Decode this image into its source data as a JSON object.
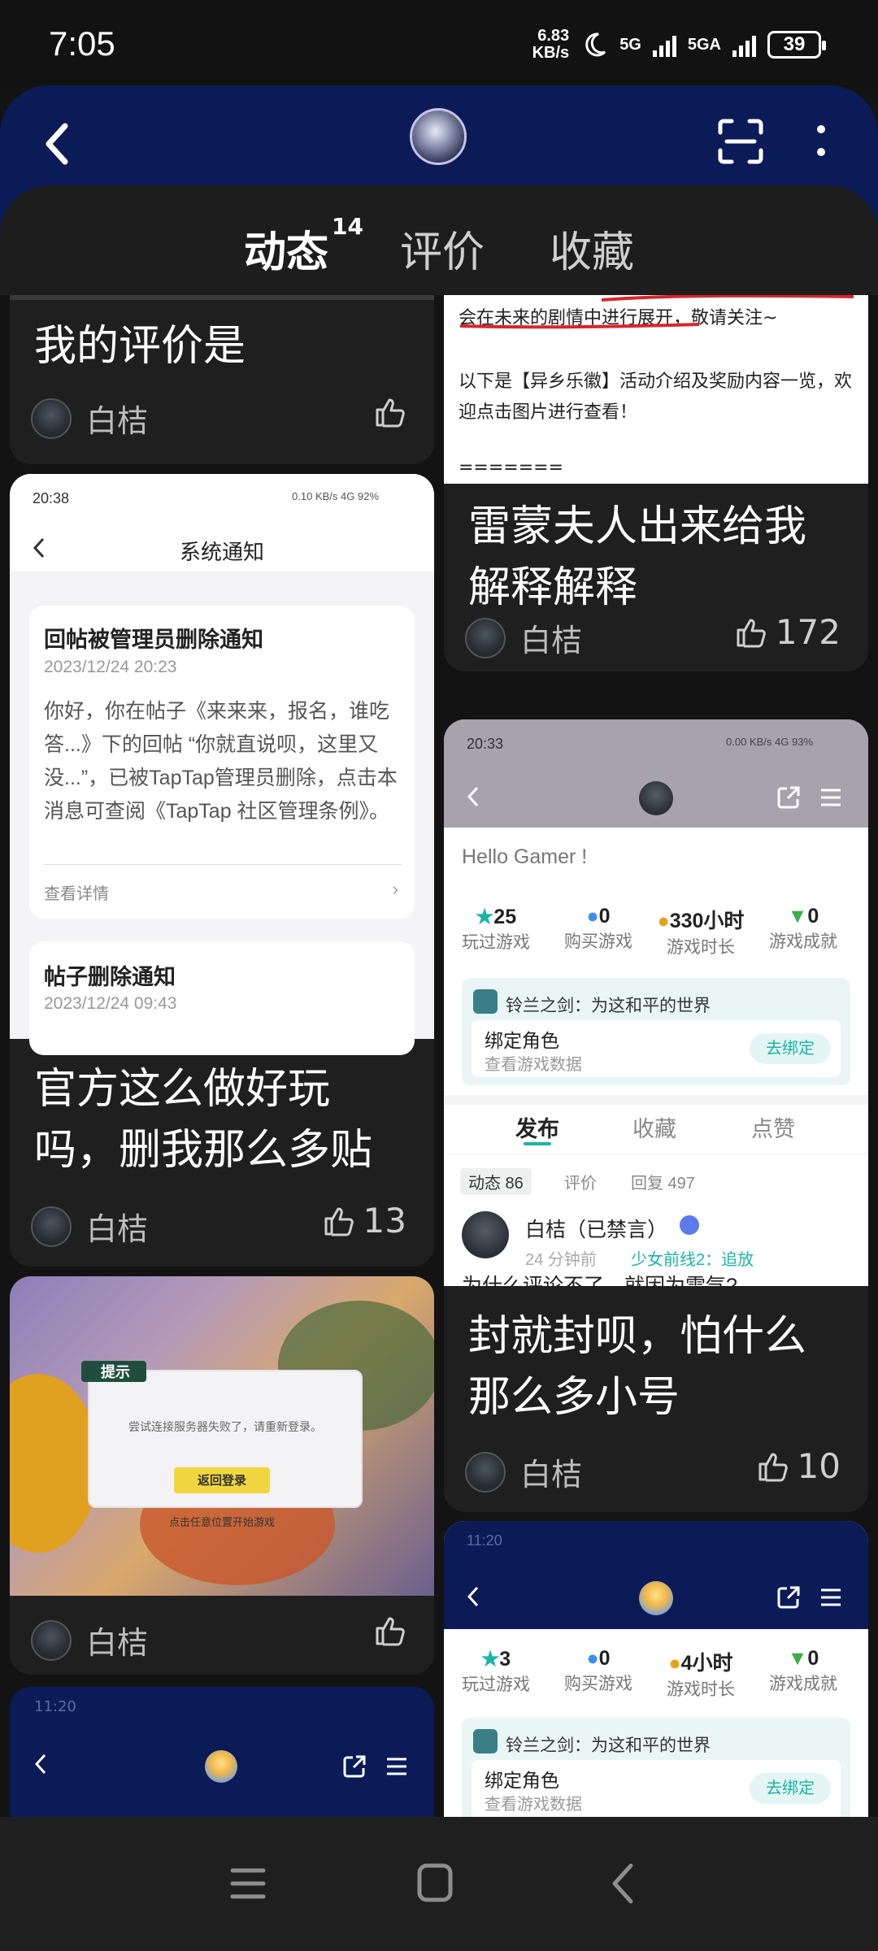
{
  "status_bar": {
    "time": "7:05",
    "speed_value": "6.83",
    "speed_unit": "KB/s",
    "net1": "5G",
    "net2": "5GA",
    "battery": "39"
  },
  "tabs": [
    {
      "label": "动态",
      "count": "14"
    },
    {
      "label": "评价"
    },
    {
      "label": "收藏"
    }
  ],
  "left_column": {
    "card1": {
      "title": "我的评价是",
      "author": "白桔",
      "likes": ""
    },
    "card2": {
      "shot": {
        "time": "20:38",
        "status": "0.10 KB/s  4G  92%",
        "title": "系统通知",
        "notice1_title": "回帖被管理员删除通知",
        "notice1_date": "2023/12/24 20:23",
        "notice1_body": "你好，你在帖子《来来来，报名，谁吃答...》下的回帖 “你就直说呗，这里又没...”，已被TapTap管理员删除，点击本消息可查阅《TapTap 社区管理条例》。",
        "notice1_link": "查看详情",
        "notice2_title": "帖子删除通知",
        "notice2_date": "2023/12/24 09:43"
      },
      "title": "官方这么做好玩吗，删我那么多贴",
      "author": "白桔",
      "likes": "13"
    },
    "card3": {
      "dialog_title": "提示",
      "dialog_text": "尝试连接服务器失败了，请重新登录。",
      "dialog_button": "返回登录",
      "bottom_text": "点击任意位置开始游戏",
      "author": "白桔",
      "likes": ""
    },
    "card4": {
      "time": "11:20"
    }
  },
  "right_column": {
    "card1": {
      "text_line1": "会在未来的剧情中进行展开，敬请关注~",
      "text_line2": "以下是【异乡乐徽】活动介绍及奖励内容一览，欢迎点击图片进行查看！",
      "text_line3": "=======",
      "title": "雷蒙夫人出来给我解释解释",
      "author": "白桔",
      "likes": "172"
    },
    "card2": {
      "time": "20:33",
      "status": "0.00 KB/s  4G  93%",
      "greeting": "Hello Gamer !",
      "stats": [
        {
          "value": "25",
          "label": "玩过游戏"
        },
        {
          "value": "0",
          "label": "购买游戏"
        },
        {
          "value": "330小时",
          "label": "游戏时长"
        },
        {
          "value": "0",
          "label": "游戏成就"
        }
      ],
      "game_name": "铃兰之剑：为这和平的世界",
      "bind_title": "绑定角色",
      "bind_sub": "查看游戏数据",
      "bind_button": "去绑定",
      "subtabs": [
        "发布",
        "收藏",
        "点赞"
      ],
      "filters": [
        "动态 86",
        "评价",
        "回复 497"
      ],
      "post_user": "白桔（已禁言）",
      "post_time": "24 分钟前",
      "post_game": "少女前线2：追放",
      "post_preview": "为什么评论不了，就因为雷气?",
      "title": "封就封呗，怕什么那么多小号",
      "author": "白桔",
      "likes": "10"
    },
    "card3": {
      "time": "11:20",
      "stats": [
        {
          "value": "3",
          "label": "玩过游戏"
        },
        {
          "value": "0",
          "label": "购买游戏"
        },
        {
          "value": "4小时",
          "label": "游戏时长"
        },
        {
          "value": "0",
          "label": "游戏成就"
        }
      ],
      "game_name": "铃兰之剑：为这和平的世界",
      "bind_title": "绑定角色",
      "bind_sub": "查看游戏数据",
      "bind_button": "去绑定"
    }
  }
}
